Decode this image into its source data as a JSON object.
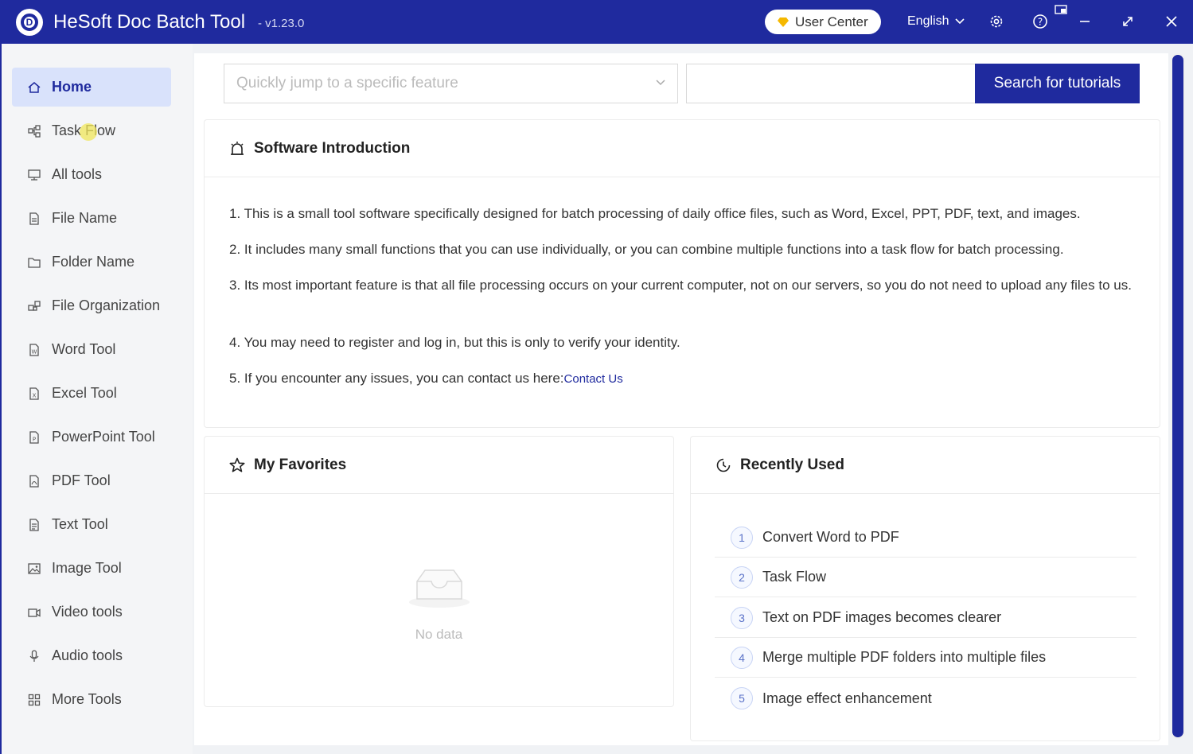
{
  "app": {
    "title": "HeSoft Doc Batch Tool",
    "version": "- v1.23.0",
    "user_center_label": "User Center",
    "language": "English"
  },
  "colors": {
    "brand": "#1f2a9e",
    "active_bg": "#d9e2fb"
  },
  "sidebar": {
    "items": [
      {
        "label": "Home",
        "icon": "home-icon",
        "active": true
      },
      {
        "label": "Task Flow",
        "icon": "task-flow-icon"
      },
      {
        "label": "All tools",
        "icon": "monitor-icon"
      },
      {
        "label": "File Name",
        "icon": "file-icon"
      },
      {
        "label": "Folder Name",
        "icon": "folder-icon"
      },
      {
        "label": "File Organization",
        "icon": "organize-icon"
      },
      {
        "label": "Word Tool",
        "icon": "word-file-icon"
      },
      {
        "label": "Excel Tool",
        "icon": "excel-file-icon"
      },
      {
        "label": "PowerPoint Tool",
        "icon": "powerpoint-file-icon"
      },
      {
        "label": "PDF Tool",
        "icon": "pdf-file-icon"
      },
      {
        "label": "Text Tool",
        "icon": "text-file-icon"
      },
      {
        "label": "Image Tool",
        "icon": "image-icon"
      },
      {
        "label": "Video tools",
        "icon": "video-icon"
      },
      {
        "label": "Audio tools",
        "icon": "microphone-icon"
      },
      {
        "label": "More Tools",
        "icon": "grid-icon"
      }
    ]
  },
  "search": {
    "jump_placeholder": "Quickly jump to a specific feature",
    "tutorial_value": "",
    "tutorial_button": "Search for tutorials"
  },
  "intro": {
    "title": "Software Introduction",
    "lines": [
      "1. This is a small tool software specifically designed for batch processing of daily office files, such as Word, Excel, PPT, PDF, text, and images.",
      "2. It includes many small functions that you can use individually, or you can combine multiple functions into a task flow for batch processing.",
      "3. Its most important feature is that all file processing occurs on your current computer, not on our servers, so you do not need to upload any files to us.",
      "4. You may need to register and log in, but this is only to verify your identity.",
      "5. If you encounter any issues, you can contact us here:"
    ],
    "contact_link": "Contact Us"
  },
  "favorites": {
    "title": "My Favorites",
    "empty_text": "No data"
  },
  "recent": {
    "title": "Recently Used",
    "items": [
      {
        "num": "1",
        "label": "Convert Word to PDF"
      },
      {
        "num": "2",
        "label": "Task Flow"
      },
      {
        "num": "3",
        "label": "Text on PDF images becomes clearer"
      },
      {
        "num": "4",
        "label": "Merge multiple PDF folders into multiple files"
      },
      {
        "num": "5",
        "label": "Image effect enhancement"
      }
    ]
  }
}
